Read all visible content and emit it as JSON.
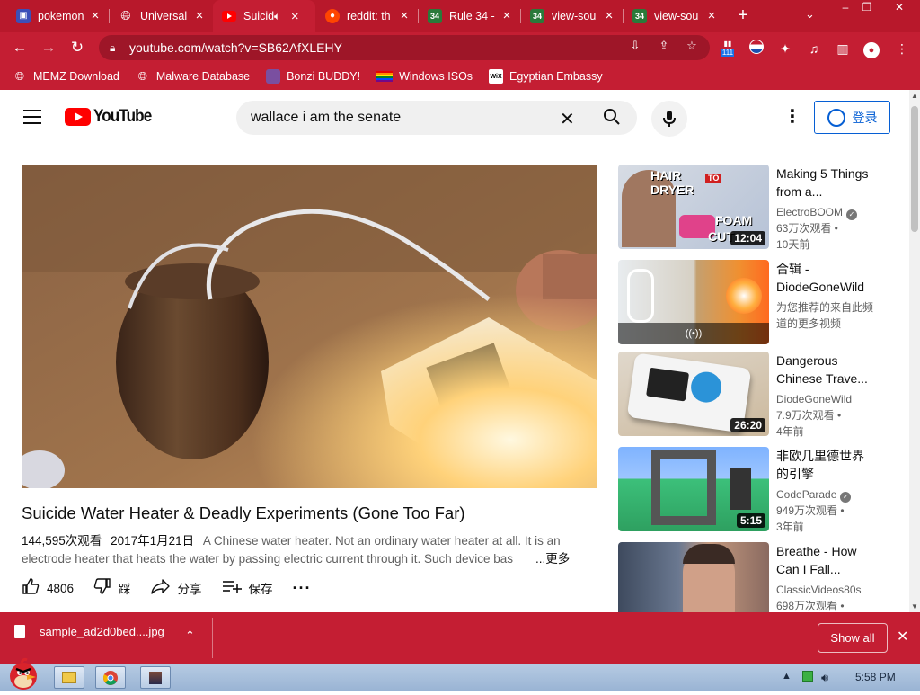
{
  "browser": {
    "tabs": [
      {
        "title": "pokemon",
        "icon": "tab-generic-icon",
        "active": false
      },
      {
        "title": "Universal",
        "icon": "globe-icon",
        "active": false
      },
      {
        "title": "Suicid",
        "icon": "youtube-icon",
        "active": true
      },
      {
        "title": "reddit: th",
        "icon": "reddit-icon",
        "active": false
      },
      {
        "title": "Rule 34 -",
        "icon": "r34-icon",
        "active": false
      },
      {
        "title": "view-sou",
        "icon": "r34-icon",
        "active": false
      },
      {
        "title": "view-sou",
        "icon": "r34-icon",
        "active": false
      }
    ],
    "r34_favicon_text": "34",
    "url": "youtube.com/watch?v=SB62AfXLEHY",
    "ext_badge": "111",
    "bookmarks": [
      {
        "label": "MEMZ Download",
        "icon": "globe-icon"
      },
      {
        "label": "Malware Database",
        "icon": "globe-icon"
      },
      {
        "label": "Bonzi BUDDY!",
        "icon": "bonzi-icon"
      },
      {
        "label": "Windows ISOs",
        "icon": "rainbow-flag-icon"
      },
      {
        "label": "Egyptian Embassy",
        "icon": "wix-icon"
      }
    ],
    "wix_favicon_text": "WiX",
    "accent_color": "#c41e33"
  },
  "youtube": {
    "logo_text": "YouTube",
    "search_value": "wallace i am the senate",
    "signin_label": "登录",
    "video": {
      "title": "Suicide Water Heater & Deadly Experiments (Gone Too Far)",
      "views": "144,595次观看",
      "date": "2017年1月21日",
      "description_line1": "A Chinese water heater. Not an ordinary water heater at all. It is an",
      "description_line2": "electrode heater that heats the water by passing electric current through it. Such device bas",
      "more_label": "...更多",
      "likes": "4806",
      "dislike_label": "踩",
      "share_label": "分享",
      "save_label": "保存"
    },
    "recommendations": [
      {
        "title": "Making 5 Things from a...",
        "channel": "ElectroBOOM",
        "verified": true,
        "views": "63万次观看 •",
        "age": "10天前",
        "duration": "12:04",
        "thumb_text_1": "HAIR",
        "thumb_text_2": "DRYER",
        "thumb_text_3": "TO",
        "thumb_text_4": "FOAM",
        "thumb_text_5": "CUT"
      },
      {
        "title": "合辑 - DiodeGoneWild",
        "channel": "为您推荐的来自此频道的更多视频",
        "verified": false,
        "views": "",
        "age": "",
        "duration": ""
      },
      {
        "title": "Dangerous Chinese Trave...",
        "channel": "DiodeGoneWild",
        "verified": false,
        "views": "7.9万次观看 •",
        "age": "4年前",
        "duration": "26:20"
      },
      {
        "title": "非欧几里德世界的引擎",
        "channel": "CodeParade",
        "verified": true,
        "views": "949万次观看 •",
        "age": "3年前",
        "duration": "5:15"
      },
      {
        "title": "Breathe - How Can I Fall...",
        "channel": "ClassicVideos80s",
        "verified": false,
        "views": "698万次观看 •",
        "age": "",
        "duration": ""
      }
    ]
  },
  "downloads": {
    "filename": "sample_ad2d0bed....jpg",
    "show_all_label": "Show all"
  },
  "taskbar": {
    "clock": "5:58 PM"
  }
}
